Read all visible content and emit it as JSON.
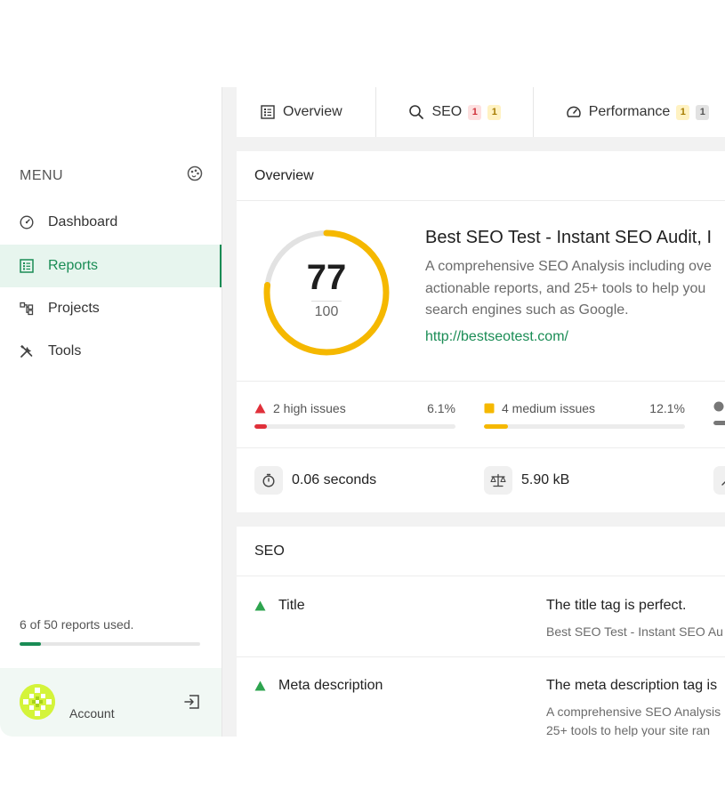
{
  "sidebar": {
    "menu_label": "MENU",
    "items": [
      {
        "label": "Dashboard",
        "icon": "gauge-icon"
      },
      {
        "label": "Reports",
        "icon": "report-list-icon",
        "active": true
      },
      {
        "label": "Projects",
        "icon": "hierarchy-icon"
      },
      {
        "label": "Tools",
        "icon": "tools-icon"
      }
    ],
    "usage_text": "6 of 50 reports used.",
    "usage_fraction": 0.12,
    "account_label": "Account"
  },
  "tabs": [
    {
      "label": "Overview",
      "icon": "list-icon",
      "badges": []
    },
    {
      "label": "SEO",
      "icon": "search-icon",
      "badges": [
        "1",
        "1"
      ]
    },
    {
      "label": "Performance",
      "icon": "speedometer-icon",
      "badges": [
        "1",
        "1"
      ]
    }
  ],
  "overview": {
    "heading": "Overview",
    "score": "77",
    "score_max": "100",
    "score_fraction": 0.77,
    "site_title": "Best SEO Test - Instant SEO Audit, I",
    "site_description": "A comprehensive SEO Analysis including ove\nactionable reports, and 25+ tools to help you\nsearch engines such as Google.",
    "site_url": "http://bestseotest.com/",
    "issues": [
      {
        "label": "2 high issues",
        "percent": "6.1%",
        "fraction": 0.061,
        "color": "#e0303a"
      },
      {
        "label": "4 medium issues",
        "percent": "12.1%",
        "fraction": 0.121,
        "color": "#f5b800"
      }
    ],
    "stats": [
      {
        "value": "0.06 seconds",
        "icon": "stopwatch-icon"
      },
      {
        "value": "5.90 kB",
        "icon": "scale-icon"
      }
    ]
  },
  "seo": {
    "heading": "SEO",
    "rows": [
      {
        "name": "Title",
        "result": "The title tag is perfect.",
        "detail": "Best SEO Test - Instant SEO Au"
      },
      {
        "name": "Meta description",
        "result": "The meta description tag is",
        "detail": "A comprehensive SEO Analysis\n25+ tools to help your site ran"
      }
    ]
  },
  "colors": {
    "accent": "#1a8c55",
    "score_arc": "#f5b800",
    "high": "#e0303a",
    "medium": "#f5b800",
    "pass": "#2ea44f"
  }
}
